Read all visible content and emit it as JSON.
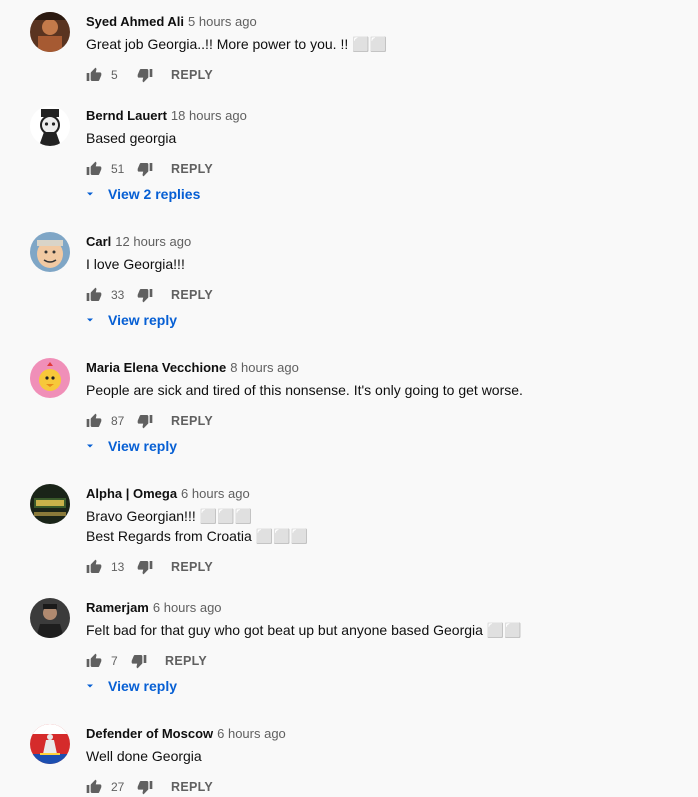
{
  "comments": [
    {
      "author": "Syed Ahmed Ali",
      "time": "5 hours ago",
      "lines": [
        "Great job Georgia..!! More power to you. !! ⬜⬜"
      ],
      "likes": "5",
      "reply": "REPLY",
      "view_replies": ""
    },
    {
      "author": "Bernd Lauert",
      "time": "18 hours ago",
      "lines": [
        "Based georgia"
      ],
      "likes": "51",
      "reply": "REPLY",
      "view_replies": "View 2 replies"
    },
    {
      "author": "Carl",
      "time": "12 hours ago",
      "lines": [
        "I love Georgia!!!"
      ],
      "likes": "33",
      "reply": "REPLY",
      "view_replies": "View reply"
    },
    {
      "author": "Maria Elena Vecchione",
      "time": "8 hours ago",
      "lines": [
        "People are sick and tired of this nonsense. It's only going to get worse."
      ],
      "likes": "87",
      "reply": "REPLY",
      "view_replies": "View reply"
    },
    {
      "author": "Alpha | Omega",
      "time": "6 hours ago",
      "lines": [
        "Bravo Georgian!!! ⬜⬜⬜",
        "Best Regards from Croatia ⬜⬜⬜"
      ],
      "likes": "13",
      "reply": "REPLY",
      "view_replies": ""
    },
    {
      "author": "Ramerjam",
      "time": "6 hours ago",
      "lines": [
        "Felt bad for that guy who got beat up but anyone based Georgia ⬜⬜"
      ],
      "likes": "7",
      "reply": "REPLY",
      "view_replies": "View reply"
    },
    {
      "author": "Defender of Moscow",
      "time": "6 hours ago",
      "lines": [
        "Well done Georgia"
      ],
      "likes": "27",
      "reply": "REPLY",
      "view_replies": ""
    }
  ],
  "colors": {
    "link": "#065fd4",
    "meta": "#606060",
    "background": "#f9f9f9"
  }
}
